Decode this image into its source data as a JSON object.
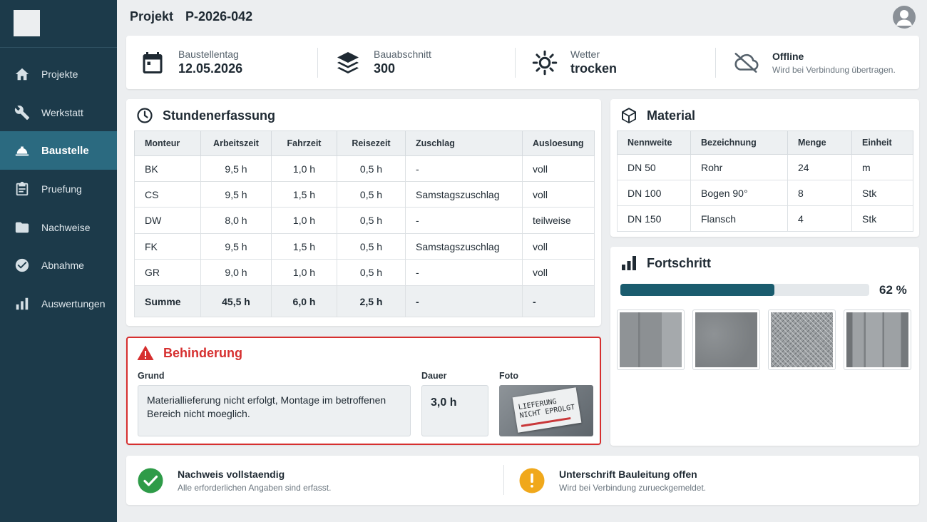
{
  "sidebar": {
    "items": [
      {
        "label": "Projekte",
        "icon": "home-icon"
      },
      {
        "label": "Werkstatt",
        "icon": "wrench-icon"
      },
      {
        "label": "Baustelle",
        "icon": "hardhat-icon",
        "active": true
      },
      {
        "label": "Pruefung",
        "icon": "clipboard-icon"
      },
      {
        "label": "Nachweise",
        "icon": "folder-icon"
      },
      {
        "label": "Abnahme",
        "icon": "check-circle-icon"
      },
      {
        "label": "Auswertungen",
        "icon": "bar-chart-icon"
      }
    ]
  },
  "header": {
    "label": "Projekt",
    "project_id": "P-2026-042"
  },
  "infobar": {
    "date": {
      "label": "Baustellentag",
      "value": "12.05.2026"
    },
    "section": {
      "label": "Bauabschnitt",
      "value": "300"
    },
    "weather": {
      "label": "Wetter",
      "value": "trocken"
    },
    "status": {
      "title": "Offline",
      "sub": "Wird bei Verbindung übertragen."
    }
  },
  "hours": {
    "title": "Stundenerfassung",
    "columns": [
      "Monteur",
      "Arbeitszeit",
      "Fahrzeit",
      "Reisezeit",
      "Zuschlag",
      "Ausloesung"
    ],
    "rows": [
      [
        "BK",
        "9,5 h",
        "1,0 h",
        "0,5 h",
        "-",
        "voll"
      ],
      [
        "CS",
        "9,5 h",
        "1,5 h",
        "0,5 h",
        "Samstagszuschlag",
        "voll"
      ],
      [
        "DW",
        "8,0 h",
        "1,0 h",
        "0,5 h",
        "-",
        "teilweise"
      ],
      [
        "FK",
        "9,5 h",
        "1,5 h",
        "0,5 h",
        "Samstagszuschlag",
        "voll"
      ],
      [
        "GR",
        "9,0 h",
        "1,0 h",
        "0,5 h",
        "-",
        "voll"
      ]
    ],
    "sum": [
      "Summe",
      "45,5 h",
      "6,0 h",
      "2,5 h",
      "-",
      "-"
    ]
  },
  "material": {
    "title": "Material",
    "columns": [
      "Nennweite",
      "Bezeichnung",
      "Menge",
      "Einheit"
    ],
    "rows": [
      [
        "DN 50",
        "Rohr",
        "24",
        "m"
      ],
      [
        "DN 100",
        "Bogen 90°",
        "8",
        "Stk"
      ],
      [
        "DN 150",
        "Flansch",
        "4",
        "Stk"
      ]
    ]
  },
  "progress": {
    "title": "Fortschritt",
    "percent": 62,
    "percent_label": "62 %"
  },
  "obstruction": {
    "title": "Behinderung",
    "reason_label": "Grund",
    "reason": "Materiallieferung nicht erfolgt, Montage im betroffenen Bereich nicht moeglich.",
    "duration_label": "Dauer",
    "duration": "3,0 h",
    "photo_label": "Foto",
    "photo_text_1": "LIEFERUNG",
    "photo_text_2": "NICHT EPROLGT"
  },
  "footer": {
    "complete": {
      "title": "Nachweis vollstaendig",
      "sub": "Alle erforderlichen Angaben sind erfasst."
    },
    "signature": {
      "title": "Unterschrift Bauleitung offen",
      "sub": "Wird bei Verbindung zurueckgemeldet."
    }
  },
  "colors": {
    "sidebar": "#1c3a4a",
    "active": "#2b6a80",
    "progress": "#1a5c6e",
    "alert": "#d62f2f",
    "success": "#2e9b48",
    "warning": "#f0a81b"
  }
}
